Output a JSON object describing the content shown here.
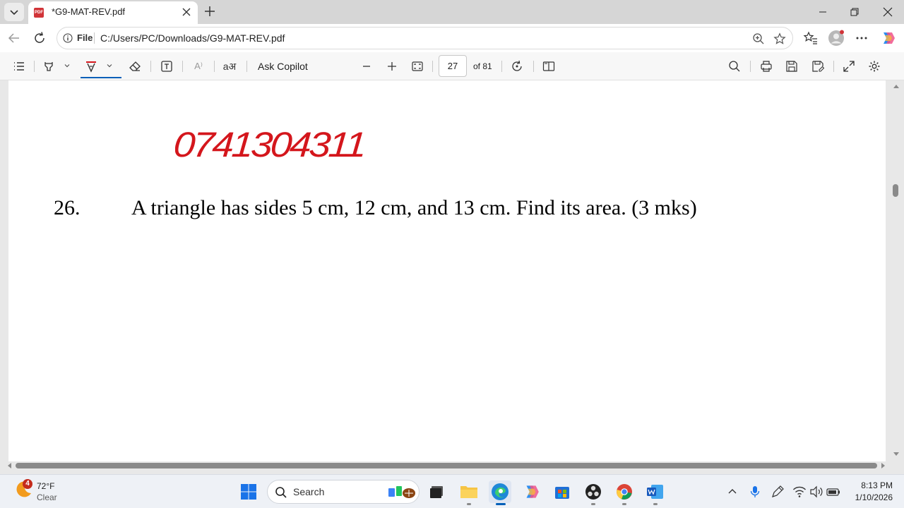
{
  "browser": {
    "tab_title": "*G9-MAT-REV.pdf",
    "pdf_icon_text": "PDF",
    "url_scheme_label": "File",
    "url": "C:/Users/PC/Downloads/G9-MAT-REV.pdf"
  },
  "pdf_toolbar": {
    "ask_copilot": "Ask Copilot",
    "read_aloud_glyph": "A⁾",
    "translate_glyph": "aअ",
    "current_page": "27",
    "page_total": "of 81",
    "accent_color": "#005fb8"
  },
  "document": {
    "handwritten_phone": "0741304311",
    "handwritten_color": "#d4161c",
    "question_number": "26.",
    "question_text": "A triangle has sides 5 cm, 12 cm, and 13 cm. Find its area. (3 mks)"
  },
  "taskbar": {
    "weather_badge": "4",
    "weather_temp": "72°F",
    "weather_desc": "Clear",
    "search_label": "Search",
    "clock_time": "8:13 PM",
    "clock_date": "1/10/2026",
    "apps": [
      "start-icon",
      "search-icon",
      "file-explorer-icon",
      "edge-icon",
      "copilot-icon",
      "store-icon",
      "obs-icon",
      "chrome-icon",
      "word-icon"
    ]
  }
}
